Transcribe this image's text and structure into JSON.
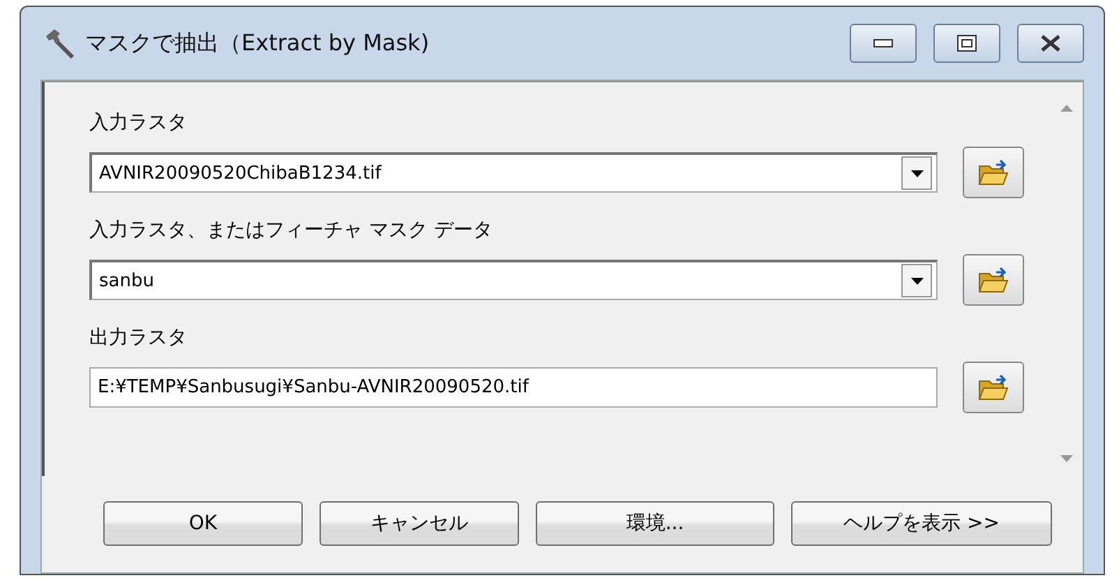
{
  "window": {
    "title": "マスクで抽出（Extract by Mask)"
  },
  "fields": [
    {
      "kind": "combobox",
      "label": "入力ラスタ",
      "value": "AVNIR20090520ChibaB1234.tif"
    },
    {
      "kind": "combobox",
      "label": "入力ラスタ、またはフィーチャ マスク データ",
      "value": "sanbu"
    },
    {
      "kind": "textbox",
      "label": "出力ラスタ",
      "value": "E:¥TEMP¥Sanbusugi¥Sanbu-AVNIR20090520.tif"
    }
  ],
  "buttons": [
    {
      "label": "OK"
    },
    {
      "label": "キャンセル"
    },
    {
      "label": "環境..."
    },
    {
      "label": "ヘルプを表示 >>"
    }
  ]
}
